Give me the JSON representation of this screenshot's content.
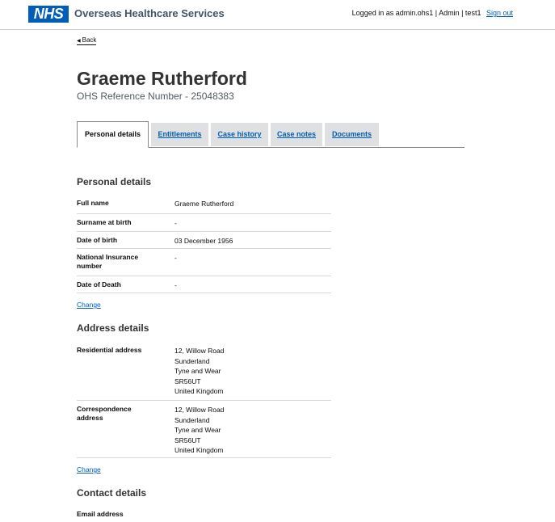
{
  "header": {
    "logo_text": "NHS",
    "service_name": "Overseas Healthcare Services",
    "logged_in_text": "Logged in as admin.ohs1 | Admin | test1",
    "sign_out_label": "Sign out"
  },
  "back_label": "Back",
  "person": {
    "name": "Graeme Rutherford",
    "reference": "OHS Reference Number - 25048383"
  },
  "tabs": [
    {
      "label": "Personal details"
    },
    {
      "label": "Entitlements"
    },
    {
      "label": "Case history"
    },
    {
      "label": "Case notes"
    },
    {
      "label": "Documents"
    }
  ],
  "personal": {
    "heading": "Personal details",
    "rows": [
      {
        "key": "Full name",
        "value": "Graeme Rutherford"
      },
      {
        "key": "Surname at birth",
        "value": "-"
      },
      {
        "key": "Date of birth",
        "value": "03 December 1956"
      },
      {
        "key": "National Insurance number",
        "value": "-"
      },
      {
        "key": "Date of Death",
        "value": "-"
      }
    ],
    "change_label": "Change"
  },
  "address": {
    "heading": "Address details",
    "rows": [
      {
        "key": "Residential address",
        "value": "12, Willow Road\nSunderland\nTyne and Wear\nSR56UT\nUnited Kingdom"
      },
      {
        "key": "Correspondence address",
        "value": "12, Willow Road\nSunderland\nTyne and Wear\nSR56UT\nUnited Kingdom"
      }
    ],
    "change_label": "Change"
  },
  "contact": {
    "heading": "Contact details",
    "first_row_key": "Email address"
  }
}
